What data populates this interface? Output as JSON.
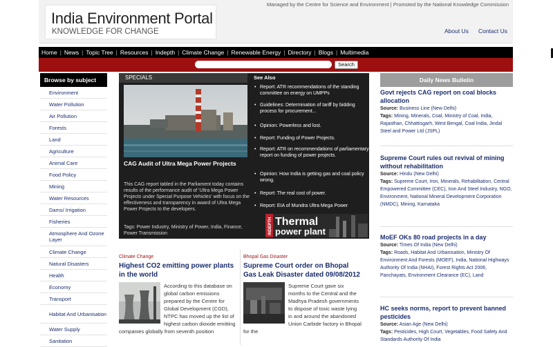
{
  "header": {
    "logo_title": "India Environment Portal",
    "logo_tagline": "KNOWLEDGE FOR CHANGE",
    "top_note": "Managed by the Centre for Science and Environment  |  Promoted by the National Knowledge Commission",
    "links": [
      "About Us",
      "Contact Us"
    ]
  },
  "nav": {
    "items": [
      "Home",
      "News",
      "Topic Tree",
      "Resources",
      "Indepth",
      "Climate Change",
      "Renewable Energy",
      "Directory",
      "Blogs",
      "Multimedia"
    ],
    "separator": "|"
  },
  "search": {
    "input_value": "",
    "button_label": "Search"
  },
  "sidebar": {
    "header": "Browse by subject",
    "items": [
      "Environment",
      "Water Pollution",
      "Air Pollution",
      "Forests",
      "Land",
      "Agriculture",
      "Animal Care",
      "Food Policy",
      "Mining",
      "Water Resources",
      "Dams/ Irrigation",
      "Fisheries",
      "Atmosphere And Ozone Layer",
      "Climate Change",
      "Natural Disasters",
      "Health",
      "Economy",
      "Transport",
      "Habitat And Urbanisation",
      "Water Supply",
      "Sanitation"
    ]
  },
  "featured": {
    "label": "SPECIALS",
    "title": "CAG Audit of Ultra Mega Power Projects",
    "description": "This CAG report tabled in the Parliament today contains results of the performance audit of 'Ultra Mega Power Projects under Special Purpose Vehicles' with focus on the effectiveness and transparency in award of Ultra Mega Power Projects to the developers.",
    "tags": "Tags: Power Industry, Ministry of Power, India, Finance, Power Transmission",
    "see_also_title": "See Also",
    "see_also": [
      "Report: ATR recommendations of the standing committee on energy on UMPPs",
      "Guidelines: Determination of tariff by bidding process for procurement...",
      "Opinion: Powerless and lost.",
      "Report: Funding of Power Projects.",
      "Report: ATR on recommendations of parliamentary report on funding of power projects.",
      "Opinion: How India is getting gas and coal policy wrong.",
      "Report: The real cost of power.",
      "Report: EIA of Mundra Ultra Mega Power"
    ],
    "banner": {
      "kicker": "INDEPTH",
      "line1": "Thermal",
      "line2": "power plant"
    }
  },
  "stories": [
    {
      "category": "Climate Change",
      "title": "Highest CO2 emitting power plants in the world",
      "body": "According to this database on global carbon emissions prepared by the Centre for Global Development (CGD), NTPC has moved up the list of highest carbon dioxide emitting companies globally from seventh position"
    },
    {
      "category": "Bhopal Gas Disaster",
      "title": "Supreme Court order on Bhopal Gas Leak Disaster dated 09/08/2012",
      "body": "Supreme Court gave six months to the Central and the Madhya Pradesh governments to dispose of toxic waste lying in and around the abandoned Union Carbide factory in Bhopal for the"
    }
  ],
  "bulletin": {
    "header": "Daily News Bulletin",
    "source_label": "Source:",
    "tags_label": "Tags:",
    "items": [
      {
        "title": "Govt rejects CAG report on coal blocks allocation",
        "source": "Business Line (New Delhi)",
        "tags": "Mining, Minerals, Coal, Ministry of Coal, India, Rajasthan, Chhattisgarh, West Bengal, Coal India, Jindal Steel and Power Ltd (JSPL)"
      },
      {
        "title": "Supreme Court rules out revival of mining without rehabilitation",
        "source": "Hindu (New Delhi)",
        "tags": "Supreme Court, Iron, Minerals, Rehabilitation, Central Empowered Committee (CEC), Iron And Steel Industry, NGO, Environment, National Mineral Development Corporation (NMDC), Mining, Karnataka"
      },
      {
        "title": "MoEF OKs 80 road projects in a day",
        "source": "Times Of India (New Delhi)",
        "tags": "Roads, Habitat And Urbanisation, Ministry Of Environment And Forests (MOEF), India, National Highways Authority Of India (NHAI), Forest Rights Act 2006, Panchayats, Environment Clearance (EC), Land"
      },
      {
        "title": "HC seeks norms, report to prevent banned pesticides",
        "source": "Asian Age (New Delhi)",
        "tags": "Pesticides, High Court, Vegetables, Food Safety And Standards Authority Of India"
      }
    ]
  }
}
